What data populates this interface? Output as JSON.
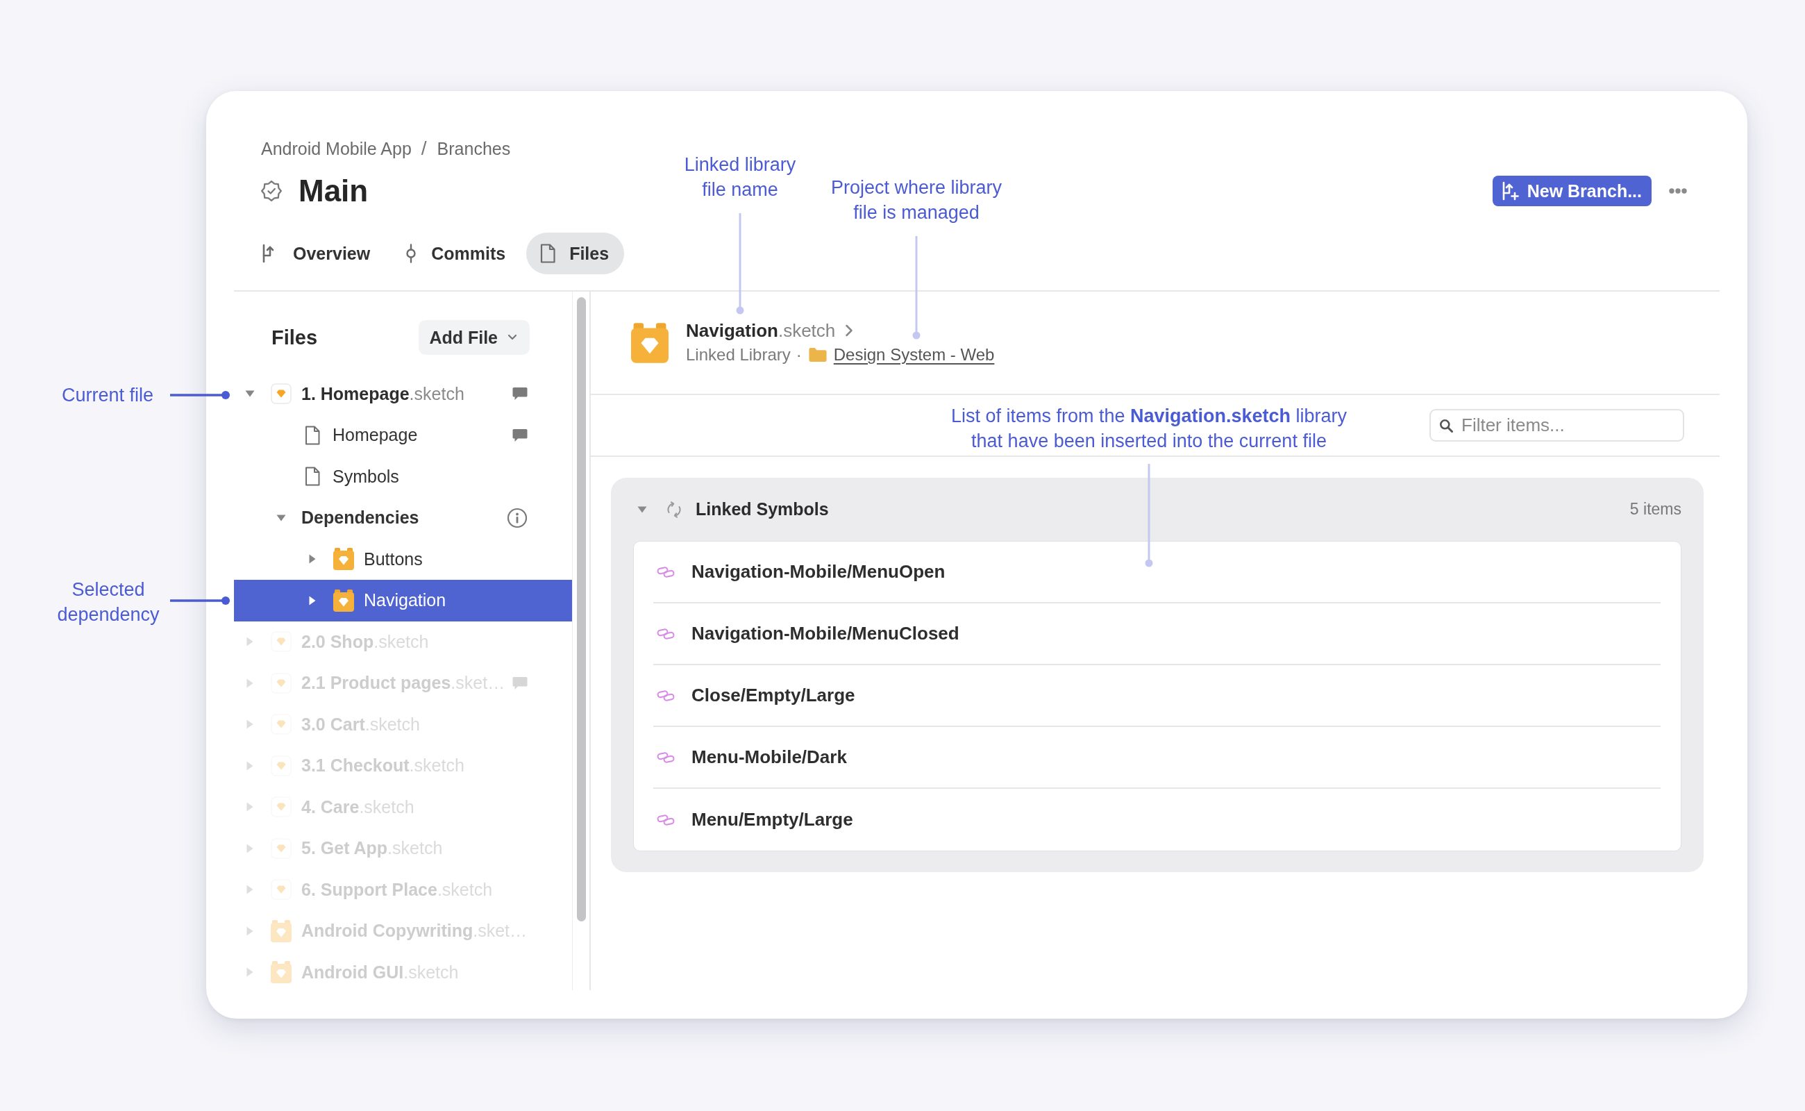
{
  "breadcrumb": {
    "items": [
      "Android Mobile App",
      "Branches"
    ],
    "separator": "/"
  },
  "branch": {
    "title": "Main",
    "new_branch_button": "New Branch..."
  },
  "tabs": [
    {
      "kind": "overview",
      "label": "Overview",
      "selected": false
    },
    {
      "kind": "commits",
      "label": "Commits",
      "selected": false
    },
    {
      "kind": "files",
      "label": "Files",
      "selected": true
    }
  ],
  "sidebar": {
    "title": "Files",
    "add_button": "Add File",
    "tree": [
      {
        "kind": "document",
        "label": "**1. Homepage**.sketch",
        "expanded": true,
        "selected": false,
        "dimmed": false,
        "comments": true,
        "children": [
          {
            "kind": "page",
            "label": "Homepage",
            "selected": false,
            "comments": true,
            "info": false
          },
          {
            "kind": "page",
            "label": "Symbols",
            "selected": false,
            "comments": false,
            "info": false
          },
          {
            "kind": "group",
            "label": "Dependencies",
            "expanded": true,
            "selected": false,
            "comments": false,
            "info": true,
            "children": [
              {
                "kind": "library",
                "label": "Buttons",
                "expanded": false,
                "selected": false
              },
              {
                "kind": "library",
                "label": "Navigation",
                "expanded": false,
                "selected": true
              }
            ]
          }
        ]
      },
      {
        "kind": "document",
        "label": "**2.0 Shop**.sketch",
        "expanded": false,
        "selected": false,
        "dimmed": true,
        "comments": false
      },
      {
        "kind": "document",
        "label": "**2.1 Product pages**.sket…",
        "expanded": false,
        "selected": false,
        "dimmed": true,
        "comments": true
      },
      {
        "kind": "document",
        "label": "**3.0 Cart**.sketch",
        "expanded": false,
        "selected": false,
        "dimmed": true,
        "comments": false
      },
      {
        "kind": "document",
        "label": "**3.1 Checkout**.sketch",
        "expanded": false,
        "selected": false,
        "dimmed": true,
        "comments": false
      },
      {
        "kind": "document",
        "label": "**4. Care**.sketch",
        "expanded": false,
        "selected": false,
        "dimmed": true,
        "comments": false
      },
      {
        "kind": "document",
        "label": "**5. Get App**.sketch",
        "expanded": false,
        "selected": false,
        "dimmed": true,
        "comments": false
      },
      {
        "kind": "document",
        "label": "**6. Support Place**.sketch",
        "expanded": false,
        "selected": false,
        "dimmed": true,
        "comments": false
      },
      {
        "kind": "library",
        "label": "**Android Copywriting**.sket…",
        "expanded": false,
        "selected": false,
        "dimmed": true,
        "comments": false
      },
      {
        "kind": "library",
        "label": "**Android GUI**.sketch",
        "expanded": false,
        "selected": false,
        "dimmed": true,
        "comments": false
      }
    ]
  },
  "library": {
    "name": "**Navigation**.sketch",
    "type": "Linked Library",
    "separator": "·",
    "project": "Design System - Web"
  },
  "filter": {
    "placeholder": "Filter items..."
  },
  "linked_symbols": {
    "title": "Linked Symbols",
    "expanded": true,
    "count": "5 items",
    "items": [
      "Navigation-Mobile/MenuOpen",
      "Navigation-Mobile/MenuClosed",
      "Close/Empty/Large",
      "Menu-Mobile/Dark",
      "Menu/Empty/Large"
    ]
  },
  "annotations": {
    "current_file": "Current file",
    "selected_dependency": "Selected dependency",
    "library_file_name": "Linked library file name",
    "library_project": "Project where library file is managed",
    "inserted_items": "List of items from the **Navigation.sketch** library that have been inserted into the current file"
  }
}
